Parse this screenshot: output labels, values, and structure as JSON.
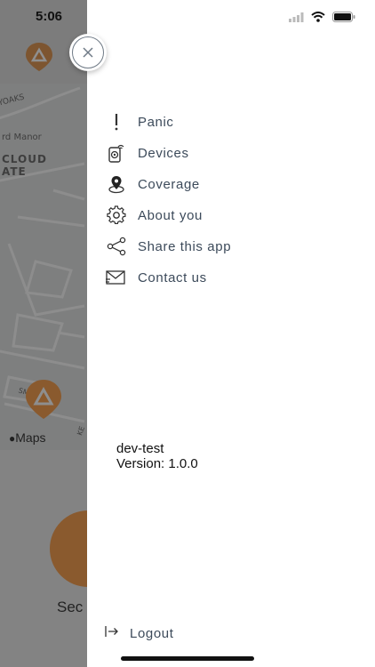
{
  "status_bar": {
    "time": "5:06"
  },
  "background": {
    "map_labels": [
      "YOAKS",
      "rd Manor",
      "CLOUD",
      "ATE",
      "SMIT STR",
      "KE"
    ],
    "maps_attribution": "Maps",
    "secure_button_partial": "Sec"
  },
  "drawer": {
    "menu": [
      {
        "id": "panic",
        "label": "Panic",
        "icon": "exclamation-icon"
      },
      {
        "id": "devices",
        "label": "Devices",
        "icon": "devices-icon"
      },
      {
        "id": "coverage",
        "label": "Coverage",
        "icon": "location-pin-icon"
      },
      {
        "id": "about-you",
        "label": "About you",
        "icon": "gear-icon"
      },
      {
        "id": "share",
        "label": "Share this app",
        "icon": "share-icon"
      },
      {
        "id": "contact",
        "label": "Contact us",
        "icon": "mail-icon"
      }
    ],
    "environment": "dev-test",
    "version": "Version: 1.0.0",
    "logout_label": "Logout"
  },
  "colors": {
    "accent": "#d9782e",
    "menu_text": "#3c4a5a",
    "close_ring": "#6f7a86"
  }
}
